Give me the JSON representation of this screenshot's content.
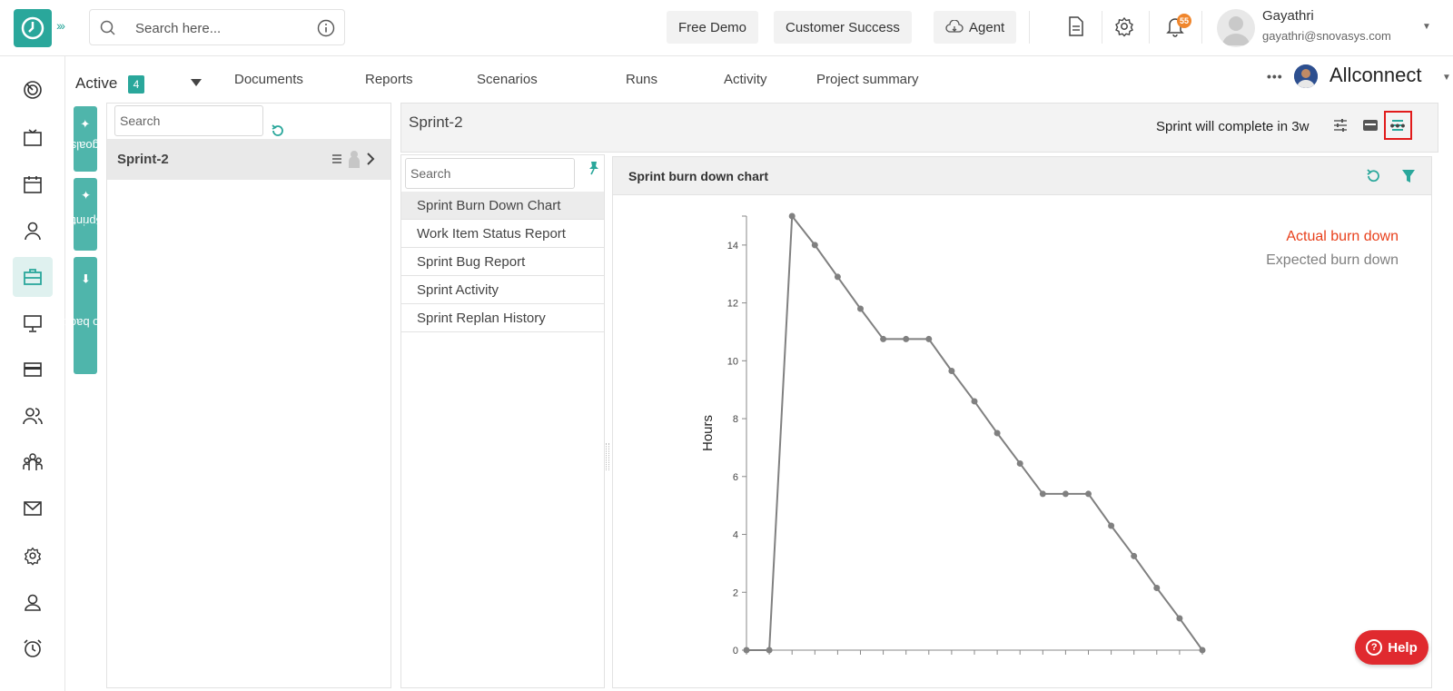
{
  "topbar": {
    "search_placeholder": "Search here...",
    "buttons": {
      "free_demo": "Free Demo",
      "customer_success": "Customer Success",
      "agent": "Agent"
    },
    "notification_count": "55",
    "user": {
      "name": "Gayathri",
      "email": "gayathri@snovasys.com"
    }
  },
  "subnav": {
    "active_label": "Active",
    "active_count": "4",
    "tabs": [
      "Documents",
      "Reports",
      "Scenarios",
      "Runs",
      "Activity",
      "Project summary"
    ],
    "project_name": "Allconnect"
  },
  "side_tabs": {
    "goals": "goals",
    "sprints": "Sprints",
    "backlog": "Go to backlog"
  },
  "sprint_panel": {
    "search_placeholder": "Search",
    "sprint_name": "Sprint-2"
  },
  "main": {
    "title": "Sprint-2",
    "status": "Sprint will complete in 3w"
  },
  "reports": {
    "search_placeholder": "Search",
    "items": [
      "Sprint Burn Down Chart",
      "Work Item Status Report",
      "Sprint Bug Report",
      "Sprint Activity",
      "Sprint Replan History"
    ]
  },
  "chart_panel": {
    "title": "Sprint burn down chart"
  },
  "help": {
    "label": "Help"
  },
  "chart_data": {
    "type": "line",
    "title": "",
    "ylabel": "Hours",
    "xlabel": "",
    "ylim": [
      0,
      15
    ],
    "yticks": [
      0,
      2,
      4,
      6,
      8,
      10,
      12,
      14
    ],
    "legend_position": "top-right",
    "series": [
      {
        "name": "Actual burn down",
        "color": "#e8401c",
        "values": []
      },
      {
        "name": "Expected burn down",
        "color": "#808080",
        "values": [
          0,
          0,
          15,
          14,
          12.9,
          11.8,
          10.75,
          10.75,
          10.75,
          9.65,
          8.6,
          7.5,
          6.45,
          5.4,
          5.4,
          5.4,
          4.3,
          3.25,
          2.15,
          1.1,
          0
        ]
      }
    ]
  }
}
